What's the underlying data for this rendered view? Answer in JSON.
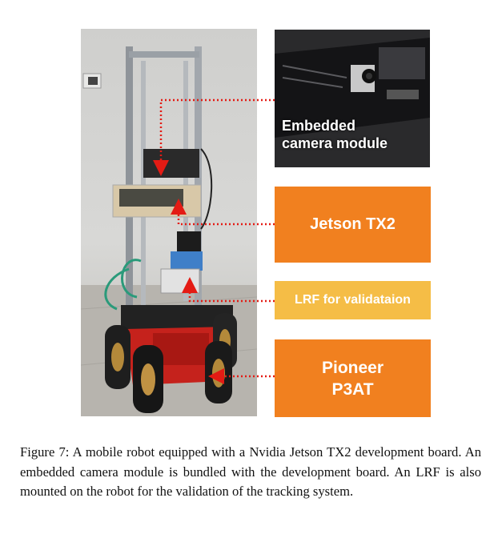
{
  "labels": {
    "camera_module_line1": "Embedded",
    "camera_module_line2": "camera module",
    "jetson": "Jetson TX2",
    "lrf": "LRF for validataion",
    "pioneer_line1": "Pioneer",
    "pioneer_line2": "P3AT"
  },
  "caption": "Figure 7: A mobile robot equipped with a Nvidia Jetson TX2 development board. An embedded camera module is bundled with the development board. An LRF is also mounted on the robot for the validation of the tracking system.",
  "colors": {
    "orange": "#f1801f",
    "light_orange": "#f5bd46",
    "pointer_red": "#e41b14"
  }
}
